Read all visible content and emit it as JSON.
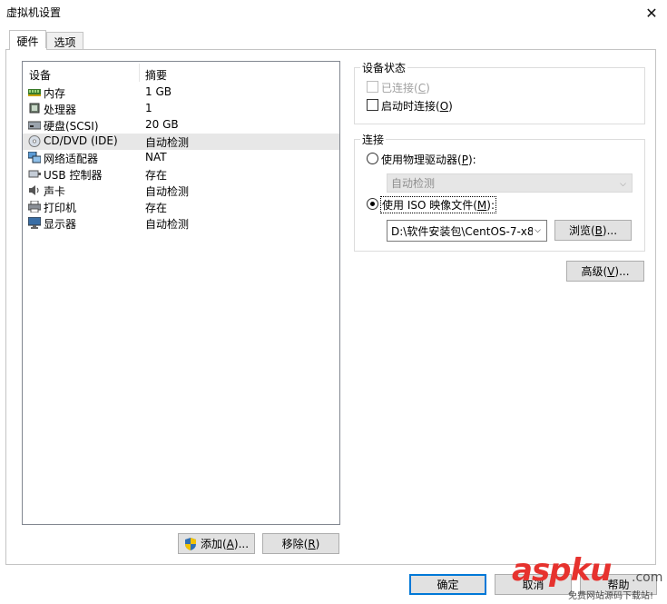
{
  "window": {
    "title": "虚拟机设置",
    "close_glyph": "✕"
  },
  "tabs": [
    {
      "label": "硬件",
      "selected": true
    },
    {
      "label": "选项",
      "selected": false
    }
  ],
  "device_list": {
    "headers": {
      "device": "设备",
      "summary": "摘要"
    },
    "rows": [
      {
        "name": "内存",
        "summary": "1 GB",
        "icon": "memory-icon",
        "selected": false
      },
      {
        "name": "处理器",
        "summary": "1",
        "icon": "processor-icon",
        "selected": false
      },
      {
        "name": "硬盘(SCSI)",
        "summary": "20 GB",
        "icon": "harddisk-icon",
        "selected": false
      },
      {
        "name": "CD/DVD (IDE)",
        "summary": "自动检测",
        "icon": "cd-dvd-icon",
        "selected": true
      },
      {
        "name": "网络适配器",
        "summary": "NAT",
        "icon": "network-adapter-icon",
        "selected": false
      },
      {
        "name": "USB 控制器",
        "summary": "存在",
        "icon": "usb-icon",
        "selected": false
      },
      {
        "name": "声卡",
        "summary": "自动检测",
        "icon": "sound-card-icon",
        "selected": false
      },
      {
        "name": "打印机",
        "summary": "存在",
        "icon": "printer-icon",
        "selected": false
      },
      {
        "name": "显示器",
        "summary": "自动检测",
        "icon": "display-icon",
        "selected": false
      }
    ]
  },
  "list_buttons": {
    "add": {
      "text": "添加(",
      "key": "A",
      "tail": ")...",
      "icon": "shield-icon"
    },
    "remove": {
      "text": "移除(",
      "key": "R",
      "tail": ")"
    }
  },
  "device_status": {
    "label": "设备状态",
    "connected": {
      "text": "已连接(",
      "key": "C",
      "tail": ")",
      "checked": false,
      "disabled": true
    },
    "connect_at_power_on": {
      "text": "启动时连接(",
      "key": "O",
      "tail": ")",
      "checked": false,
      "disabled": false
    }
  },
  "connection": {
    "label": "连接",
    "physical": {
      "text": "使用物理驱动器(",
      "key": "P",
      "tail": "):",
      "selected": false
    },
    "physical_select": {
      "value": "自动检测",
      "disabled": true
    },
    "iso": {
      "text": "使用 ISO 映像文件(",
      "key": "M",
      "tail": "):",
      "selected": true
    },
    "iso_path": "D:\\软件安装包\\CentOS-7-x8",
    "browse": {
      "text": "浏览(",
      "key": "B",
      "tail": ")..."
    }
  },
  "advanced": {
    "text": "高级(",
    "key": "V",
    "tail": ")..."
  },
  "footer": {
    "ok": "确定",
    "cancel": "取消",
    "help": "帮助"
  },
  "watermark": {
    "brand": "aspku",
    "domain": ".com",
    "tagline": "免费网站源码下载站!"
  }
}
